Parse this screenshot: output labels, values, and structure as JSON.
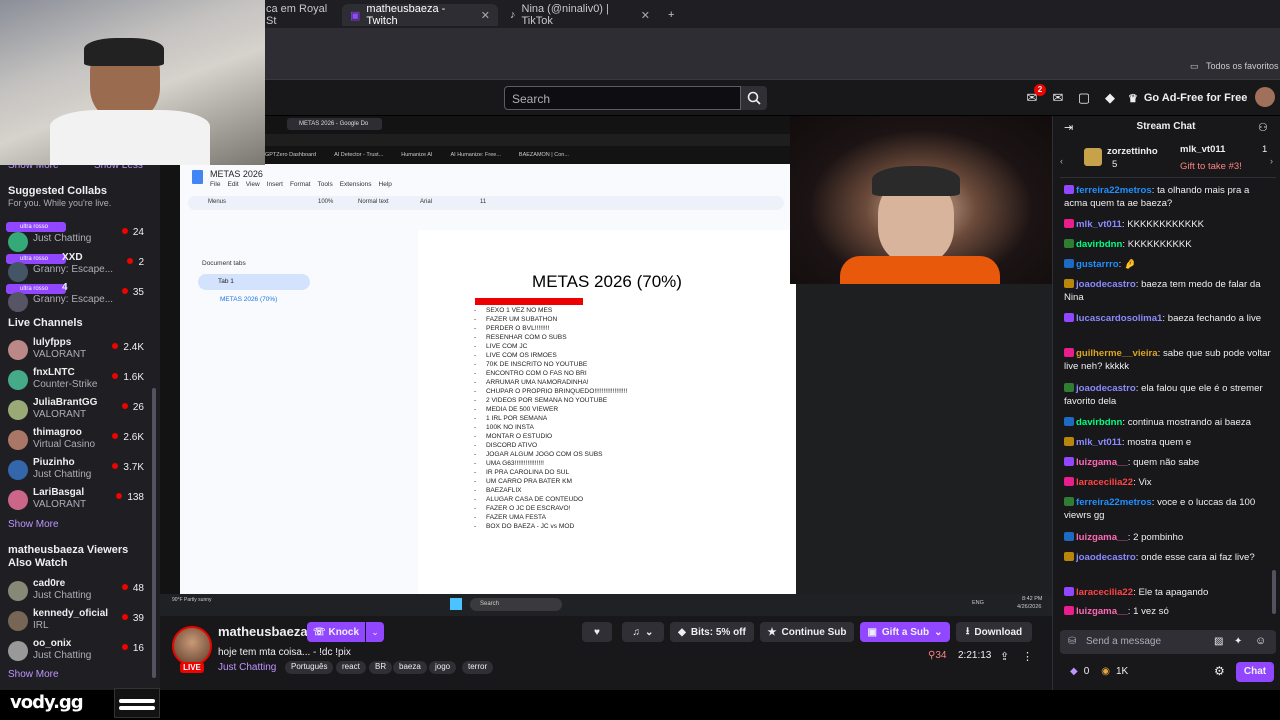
{
  "browser": {
    "tabs": [
      {
        "label": "ca em Royal St",
        "active": false
      },
      {
        "label": "matheusbaeza - Twitch",
        "active": true
      },
      {
        "label": "Nina (@ninaliv0) | TikTok",
        "active": false
      }
    ],
    "bookmarks_label": "Todos os favoritos"
  },
  "twitch": {
    "search_placeholder": "Search",
    "notifications_count": "2",
    "adfree_label": "Go Ad-Free for Free"
  },
  "sidebar": {
    "show_more_top": "Show More",
    "show_less_top": "Show Less",
    "suggested_title": "Suggested Collabs",
    "suggested_sub": "For you. While you're live.",
    "collab_badge": "ultra rosso",
    "suggested": [
      {
        "name": "",
        "game": "Just Chatting",
        "viewers": "24"
      },
      {
        "name": "XXD",
        "game": "Granny: Escape...",
        "viewers": "2"
      },
      {
        "name": "4",
        "game": "Granny: Escape...",
        "viewers": "35"
      }
    ],
    "live_title": "Live Channels",
    "live": [
      {
        "name": "lulyfpps",
        "game": "VALORANT",
        "viewers": "2.4K"
      },
      {
        "name": "fnxLNTC",
        "game": "Counter-Strike",
        "viewers": "1.6K"
      },
      {
        "name": "JuliaBrantGG",
        "game": "VALORANT",
        "viewers": "26"
      },
      {
        "name": "thimagroo",
        "game": "Virtual Casino",
        "viewers": "2.6K"
      },
      {
        "name": "Piuzinho",
        "game": "Just Chatting",
        "viewers": "3.7K"
      },
      {
        "name": "LariBasgal",
        "game": "VALORANT",
        "viewers": "138"
      }
    ],
    "show_more_live": "Show More",
    "also_watch_title": "matheusbaeza Viewers Also Watch",
    "also_watch": [
      {
        "name": "cad0re",
        "game": "Just Chatting",
        "viewers": "48"
      },
      {
        "name": "kennedy_oficial",
        "game": "IRL",
        "viewers": "39"
      },
      {
        "name": "oo_onix",
        "game": "Just Chatting",
        "viewers": "16"
      }
    ],
    "show_more_also": "Show More"
  },
  "gdoc": {
    "tab_title": "METAS 2026 - Google Do",
    "doc_name": "METAS 2026",
    "menus": [
      "File",
      "Edit",
      "View",
      "Insert",
      "Format",
      "Tools",
      "Extensions",
      "Help"
    ],
    "bookmarks": [
      "GPTZero Dashboard",
      "AI Detector - Trust...",
      "Humanize AI",
      "AI Humanize: Free...",
      "BAEZAMON | Con..."
    ],
    "toolbar_menus": "Menus",
    "zoom": "100%",
    "style": "Normal text",
    "font": "Arial",
    "font_size": "11",
    "doc_tabs_label": "Document tabs",
    "tab1": "Tab 1",
    "tab1_sub": "METAS 2026 (70%)",
    "title": "METAS 2026 (70%)",
    "goals": [
      "SEXO 1 VEZ NO MES",
      "FAZER UM SUBATHON",
      "PERDER O BVL!!!!!!!!",
      "RESENHAR COM O SUBS",
      "LIVE COM JC",
      "LIVE COM OS IRMOES",
      "70K DE INSCRITO NO YOUTUBE",
      "ENCONTRO COM O FAS NO BRI",
      "ARRUMAR UMA NAMORADINHA!",
      "CHUPAR O PROPRIO BRINQUEDO!!!!!!!!!!!!!!!!!!",
      "2 VIDEOS POR SEMANA NO YOUTUBE",
      "MEDIA DE 500 VIEWER",
      "1 IRL POR SEMANA",
      "100K NO INSTA",
      "MONTAR O ESTUDIO",
      "DISCORD ATIVO",
      "JOGAR ALGUM JOGO COM OS SUBS",
      "UMA G63!!!!!!!!!!!!!!!!",
      "IR PRA CAROLINA DO SUL",
      "UM CARRO PRA BATER KM",
      "BAEZAFLIX",
      "ALUGAR CASA DE CONTEUDO",
      "FAZER O JC DE ESCRAVO!",
      "FAZER UMA FESTA",
      "BOX DO BAEZA - JC vs MOD"
    ],
    "taskbar_search": "Search",
    "taskbar_time": "8:42 PM",
    "taskbar_date": "4/26/2026",
    "taskbar_weather": "90°F Partly sunny",
    "taskbar_lang": "ENG"
  },
  "stream": {
    "streamer": "matheusbaeza",
    "knock_label": "Knock",
    "title": "hoje tem mta coisa... - !dc !pix",
    "category": "Just Chatting",
    "tags": [
      "Português",
      "react",
      "BR",
      "baeza",
      "jogo",
      "terror"
    ],
    "live_label": "LIVE",
    "bits_label": "Bits: 5% off",
    "continue_sub": "Continue Sub",
    "gift_sub": "Gift a Sub",
    "download": "Download",
    "viewers": "34",
    "uptime": "2:21:13"
  },
  "chat": {
    "title": "Stream Chat",
    "gifters": [
      {
        "name": "zorzettinho",
        "count": "5"
      },
      {
        "name": "mlk_vt011",
        "count": "1"
      }
    ],
    "gift_cta": "Gift to take #3!",
    "messages": [
      {
        "user": "ferreira22metros",
        "color": "#1e90ff",
        "text": "ta olhando mais pra a acma quem ta ae baeza?"
      },
      {
        "user": "mlk_vt011",
        "color": "#8a8aff",
        "text": "KKKKKKKKKKKK"
      },
      {
        "user": "davirbdnn",
        "color": "#00ff7f",
        "text": "KKKKKKKKKK"
      },
      {
        "user": "gustarrro",
        "color": "#1e90ff",
        "text": "🤌"
      },
      {
        "user": "joaodecastro",
        "color": "#8a8aff",
        "text": "baeza tem medo de falar da Nina"
      },
      {
        "user": "lucascardosolima1",
        "color": "#8a8aff",
        "text": "baeza fechando a live"
      },
      {
        "user": "guilherme__vieira",
        "color": "#daa520",
        "text": "sabe que sub pode voltar live neh? kkkkk"
      },
      {
        "user": "joaodecastro",
        "color": "#8a8aff",
        "text": "ela falou que ele é o stremer favorito dela"
      },
      {
        "user": "davirbdnn",
        "color": "#00ff7f",
        "text": "continua mostrando ai baeza"
      },
      {
        "user": "mlk_vt011",
        "color": "#8a8aff",
        "text": "mostra quem e"
      },
      {
        "user": "luizgama__",
        "color": "#ff69b4",
        "text": "quem não sabe"
      },
      {
        "user": "laracecilia22",
        "color": "#ff4444",
        "text": "Vix"
      },
      {
        "user": "ferreira22metros",
        "color": "#1e90ff",
        "text": "voce e o luccas da 100 viewrs gg"
      },
      {
        "user": "luizgama__",
        "color": "#ff69b4",
        "text": "2 pombinho"
      },
      {
        "user": "joaodecastro",
        "color": "#8a8aff",
        "text": "onde esse cara ai faz live?"
      },
      {
        "user": "laracecilia22",
        "color": "#ff4444",
        "text": "Ele ta apagando"
      },
      {
        "user": "luizgama__",
        "color": "#ff69b4",
        "text": "1 vez só"
      }
    ],
    "input_placeholder": "Send a message",
    "bits": "0",
    "points": "1K",
    "chat_button": "Chat"
  },
  "overlay": {
    "logo": "vody.gg"
  }
}
